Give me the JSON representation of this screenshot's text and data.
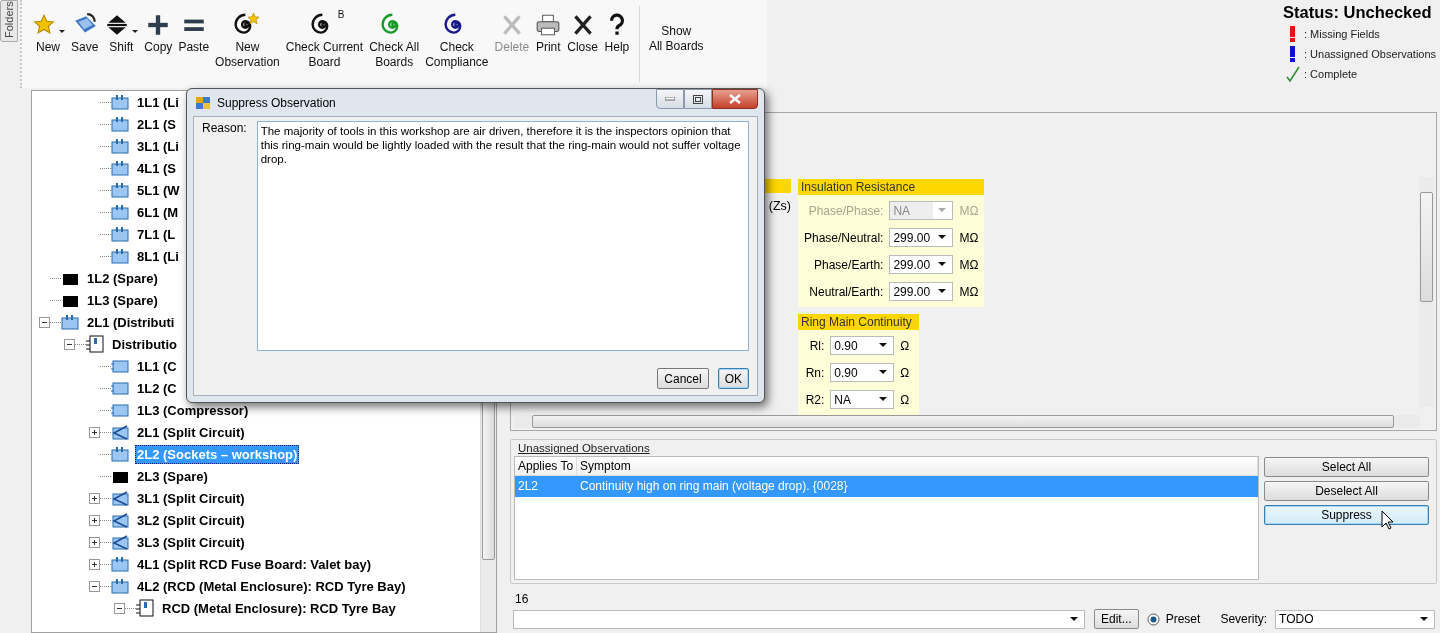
{
  "side_tab": {
    "label": "Folders"
  },
  "toolbar": {
    "buttons": [
      {
        "label": "New",
        "kind": "star",
        "dropdown": true,
        "disabled": false
      },
      {
        "label": "Save",
        "kind": "save",
        "dropdown": false,
        "disabled": false
      },
      {
        "label": "Shift",
        "kind": "shift",
        "dropdown": true,
        "disabled": false
      },
      {
        "label": "Copy",
        "kind": "plus",
        "dropdown": false,
        "disabled": false
      },
      {
        "label": "Paste",
        "kind": "equals",
        "dropdown": false,
        "disabled": false
      },
      {
        "label": "New\nObservation",
        "kind": "spiral_star",
        "color": "#111111",
        "dropdown": false,
        "disabled": false
      },
      {
        "label": "Check Current\nBoard",
        "kind": "spiral",
        "color": "#111111",
        "badge": "B",
        "dropdown": false,
        "disabled": false
      },
      {
        "label": "Check All\nBoards",
        "kind": "spiral",
        "color": "#1a9a2a",
        "dropdown": false,
        "disabled": false
      },
      {
        "label": "Check\nCompliance",
        "kind": "spiral",
        "color": "#1a1a8c",
        "dropdown": false,
        "disabled": false
      },
      {
        "label": "Delete",
        "kind": "cross",
        "dropdown": false,
        "disabled": true
      },
      {
        "label": "Print",
        "kind": "printer",
        "dropdown": false,
        "disabled": false
      },
      {
        "label": "Close",
        "kind": "cross",
        "dropdown": false,
        "disabled": false
      },
      {
        "label": "Help",
        "kind": "question",
        "dropdown": false,
        "disabled": false
      }
    ],
    "extra_button": {
      "label": "Show\nAll Boards"
    }
  },
  "status": {
    "title": "Status: Unchecked",
    "legend": [
      {
        "kind": "missing",
        "label": ": Missing Fields"
      },
      {
        "kind": "unassigned",
        "label": ": Unassigned Observations"
      },
      {
        "kind": "complete",
        "label": ": Complete"
      }
    ]
  },
  "tree": {
    "children_of_scrolled_parent": [
      {
        "label": "1L1 (Li",
        "kind": "board",
        "selected": false
      },
      {
        "label": "2L1 (S",
        "kind": "board",
        "selected": false
      },
      {
        "label": "3L1 (Li",
        "kind": "board",
        "selected": false
      },
      {
        "label": "4L1 (S",
        "kind": "board",
        "selected": false
      },
      {
        "label": "5L1 (W",
        "kind": "board",
        "selected": false
      },
      {
        "label": "6L1 (M",
        "kind": "board",
        "selected": false
      },
      {
        "label": "7L1 (L",
        "kind": "board",
        "selected": false
      },
      {
        "label": "8L1 (Li",
        "kind": "board",
        "selected": false
      }
    ],
    "nodes": [
      {
        "label": "1L2 (Spare)",
        "kind": "spare",
        "selected": false
      },
      {
        "label": "1L3 (Spare)",
        "kind": "spare",
        "selected": false
      },
      {
        "label": "2L1 (Distributi",
        "kind": "board",
        "selected": false,
        "expanded": true,
        "children": [
          {
            "label": "Distributio",
            "kind": "distribution",
            "selected": false,
            "expanded": true,
            "children": [
              {
                "label": "1L1 (C",
                "kind": "circuit",
                "selected": false
              },
              {
                "label": "1L2 (C",
                "kind": "circuit",
                "selected": false
              },
              {
                "label": "1L3 (Compressor)",
                "kind": "circuit",
                "selected": false
              },
              {
                "label": "2L1 (Split Circuit)",
                "kind": "split",
                "selected": false,
                "expanded": false
              },
              {
                "label": "2L2 (Sockets – workshop)",
                "kind": "board",
                "selected": true
              },
              {
                "label": "2L3 (Spare)",
                "kind": "spare",
                "selected": false
              },
              {
                "label": "3L1 (Split Circuit)",
                "kind": "split",
                "selected": false,
                "expanded": false
              },
              {
                "label": "3L2 (Split Circuit)",
                "kind": "split",
                "selected": false,
                "expanded": false
              },
              {
                "label": "3L3 (Split Circuit)",
                "kind": "split",
                "selected": false,
                "expanded": false
              },
              {
                "label": "4L1 (Split RCD Fuse Board: Valet bay)",
                "kind": "board",
                "selected": false,
                "expanded": false
              },
              {
                "label": "4L2 (RCD (Metal Enclosure): RCD Tyre Bay)",
                "kind": "board",
                "selected": false,
                "expanded": true,
                "children": [
                  {
                    "label": "RCD (Metal Enclosure): RCD Tyre Bay",
                    "kind": "distribution",
                    "selected": false,
                    "expanded": true
                  }
                ]
              }
            ]
          }
        ]
      }
    ]
  },
  "test_panel": {
    "partial_group": {
      "label": "(Zs)"
    },
    "insulation_resistance": {
      "title": "Insulation Resistance",
      "rows": [
        {
          "label": "Phase/Phase:",
          "value": "NA",
          "unit": "MΩ",
          "disabled": true
        },
        {
          "label": "Phase/Neutral:",
          "value": "299.00",
          "unit": "MΩ",
          "disabled": false
        },
        {
          "label": "Phase/Earth:",
          "value": "299.00",
          "unit": "MΩ",
          "disabled": false
        },
        {
          "label": "Neutral/Earth:",
          "value": "299.00",
          "unit": "MΩ",
          "disabled": false
        }
      ]
    },
    "ring_main_continuity": {
      "title": "Ring Main Continuity",
      "rows": [
        {
          "label": "Rl:",
          "value": "0.90",
          "unit": "Ω",
          "disabled": false
        },
        {
          "label": "Rn:",
          "value": "0.90",
          "unit": "Ω",
          "disabled": false
        },
        {
          "label": "R2:",
          "value": "NA",
          "unit": "Ω",
          "disabled": false
        }
      ]
    }
  },
  "observations": {
    "title": "Unassigned Observations",
    "columns": [
      "Applies To",
      "Symptom"
    ],
    "rows": [
      {
        "applies_to": "2L2",
        "symptom": "Continuity high on ring main (voltage drop). {0028}",
        "selected": true
      }
    ],
    "buttons": [
      {
        "label": "Select All",
        "focused": false
      },
      {
        "label": "Deselect All",
        "focused": false
      },
      {
        "label": "Suppress",
        "focused": true
      }
    ]
  },
  "observation_editor": {
    "number": "16",
    "edit_button": "Edit...",
    "preset": {
      "label": "Preset",
      "selected": true
    },
    "severity": {
      "label": "Severity:",
      "value": "TODO"
    }
  },
  "dialog": {
    "title": "Suppress Observation",
    "reason_label": "Reason:",
    "reason": "The majority of tools in this workshop are air driven, therefore it is the inspectors opinion that this ring-main would be lightly loaded with the result that the ring-main would not suffer voltage drop.",
    "buttons": [
      {
        "label": "Cancel",
        "default": false
      },
      {
        "label": "OK",
        "default": true
      }
    ]
  }
}
